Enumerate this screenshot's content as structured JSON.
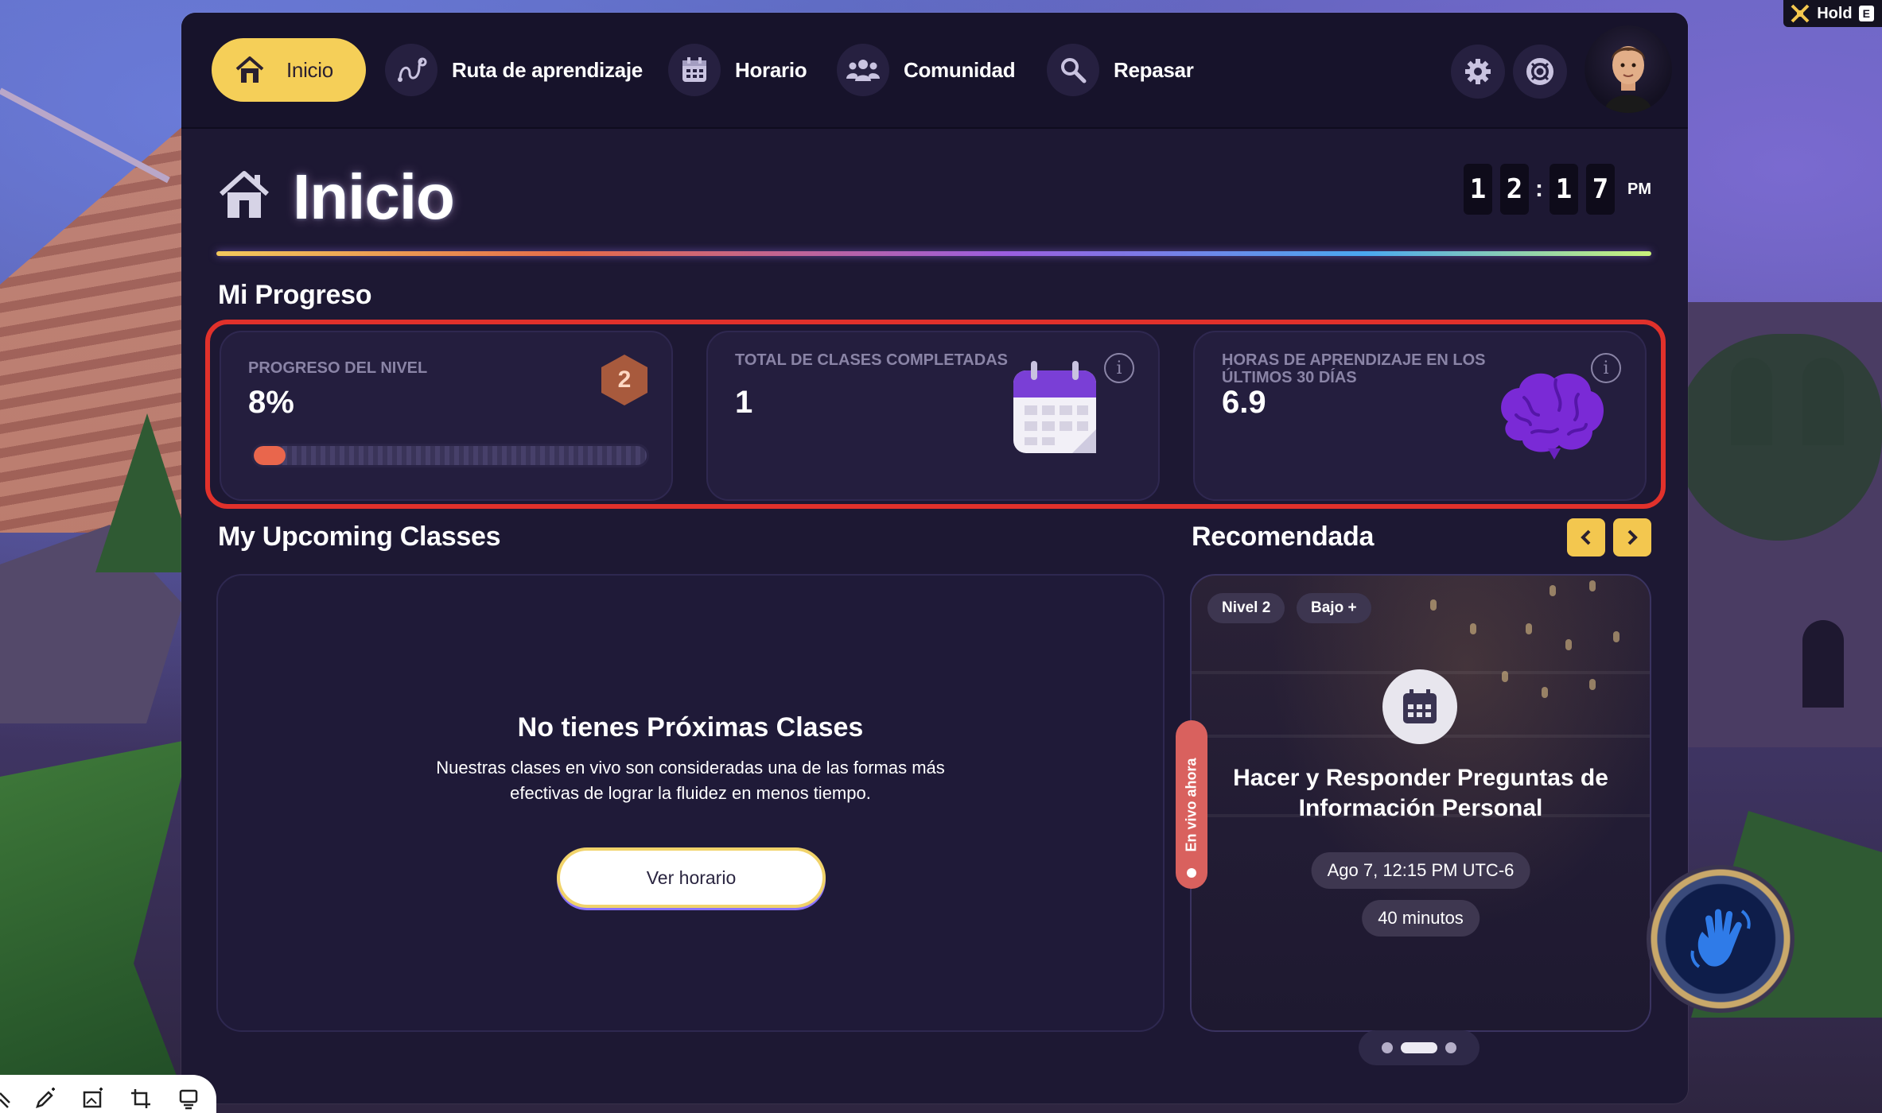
{
  "nav": {
    "items": [
      {
        "label": "Inicio",
        "icon": "home-icon"
      },
      {
        "label": "Ruta de aprendizaje",
        "icon": "route-icon"
      },
      {
        "label": "Horario",
        "icon": "calendar-icon"
      },
      {
        "label": "Comunidad",
        "icon": "community-icon"
      },
      {
        "label": "Repasar",
        "icon": "search-icon"
      }
    ],
    "settings_icon": "gear-icon",
    "help_icon": "lifebuoy-icon",
    "avatar_icon": "avatar"
  },
  "header": {
    "title": "Inicio",
    "clock": {
      "d1": "1",
      "d2": "2",
      "d3": "1",
      "d4": "7",
      "ampm": "PM"
    }
  },
  "progress": {
    "heading": "Mi Progreso",
    "level": {
      "label": "PROGRESO DEL NIVEL",
      "value": "8%",
      "fraction": 0.08,
      "badge": "2"
    },
    "classes": {
      "label": "TOTAL DE CLASES COMPLETADAS",
      "value": "1",
      "icon": "calendar-icon"
    },
    "hours": {
      "label": "HORAS DE APRENDIZAJE EN LOS ÚLTIMOS 30 DÍAS",
      "value": "6.9",
      "icon": "brain-icon"
    }
  },
  "upcoming": {
    "heading": "My Upcoming Classes",
    "empty_title": "No tienes Próximas Clases",
    "empty_desc": "Nuestras clases en vivo son consideradas una de las formas más efectivas de lograr la fluidez en menos tiempo.",
    "button": "Ver horario"
  },
  "recommended": {
    "heading": "Recomendada",
    "prev": "<",
    "next": ">",
    "tags": [
      "Nivel 2",
      "Bajo +"
    ],
    "title": "Hacer y Responder Preguntas de Información Personal",
    "datetime": "Ago 7, 12:15 PM UTC-6",
    "duration": "40 minutos",
    "live_label": "En vivo ahora",
    "page": 2,
    "pages": 3
  },
  "overlay": {
    "hold_label": "Hold",
    "hold_key": "E"
  },
  "colors": {
    "accent": "#f5cf58",
    "panel": "#1d1833",
    "highlight": "#e1312b",
    "live": "#d9615e",
    "progress_fill": "#e9664c"
  }
}
